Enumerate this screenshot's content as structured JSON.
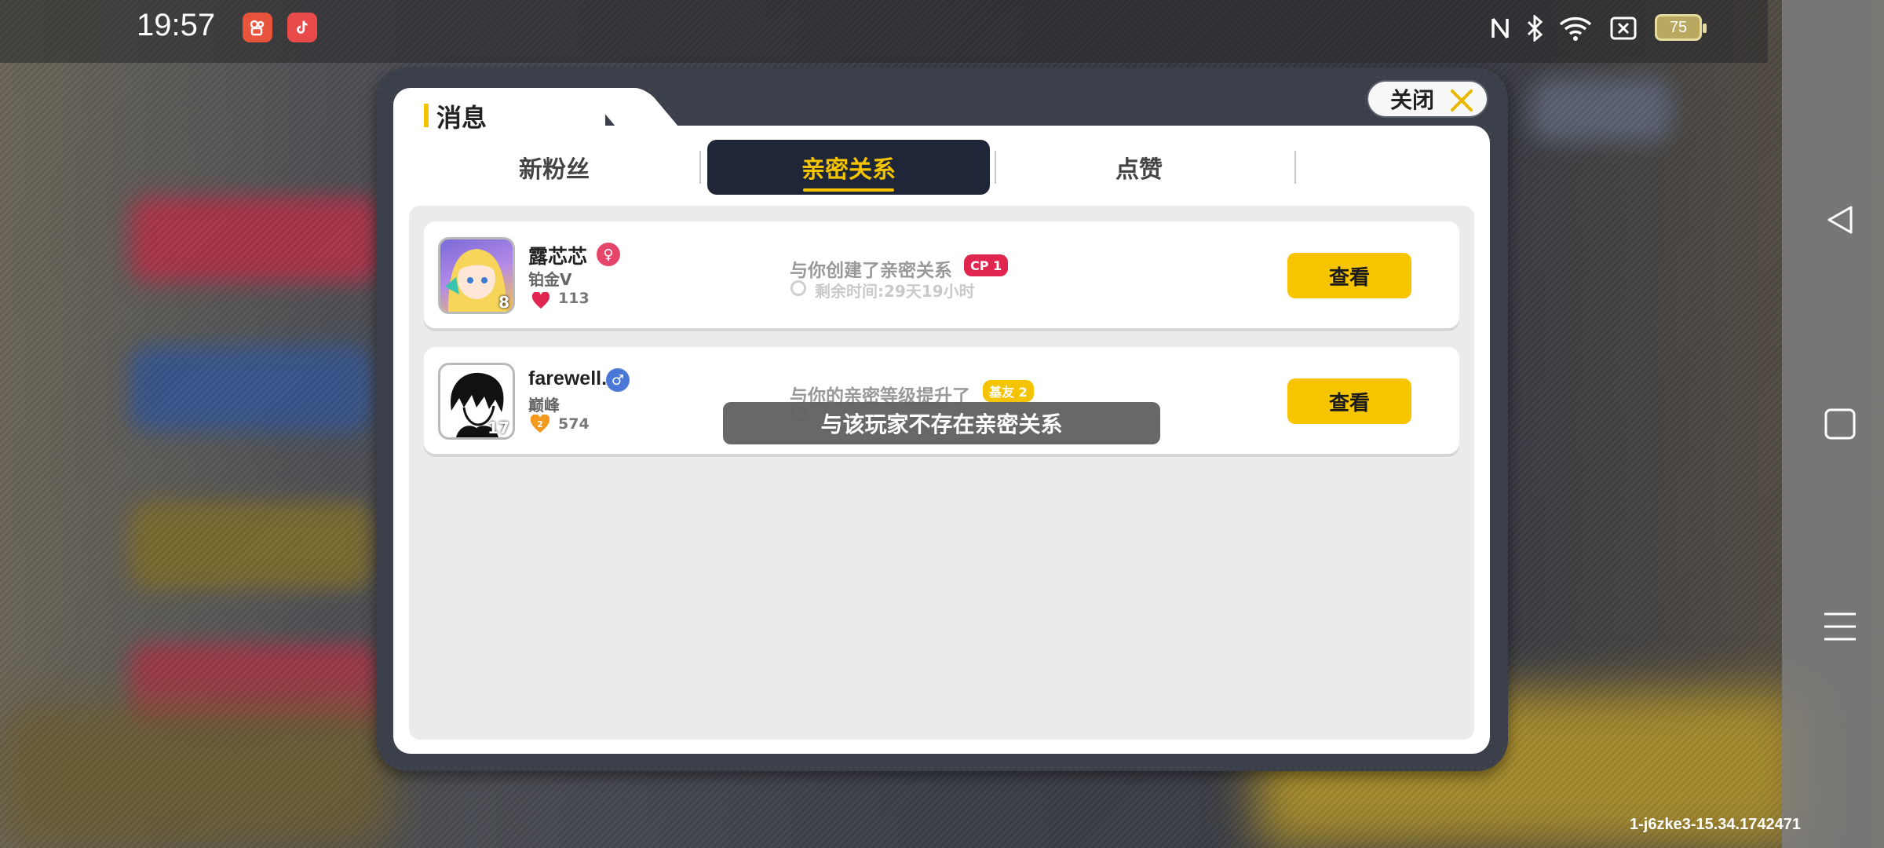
{
  "status_bar": {
    "time": "19:57",
    "battery": "75",
    "app_icons": [
      "kuaishou-icon",
      "douyin-icon"
    ],
    "system_icons": [
      "nfc-icon",
      "bluetooth-icon",
      "wifi-icon",
      "sim-off-icon",
      "battery-icon"
    ]
  },
  "dialog": {
    "title": "消息",
    "close_label": "关闭",
    "tabs": [
      {
        "label": "新粉丝",
        "active": false
      },
      {
        "label": "亲密关系",
        "active": true
      },
      {
        "label": "点赞",
        "active": false
      }
    ],
    "items": [
      {
        "name": "露芯芯",
        "gender": "female",
        "rank": "铂金V",
        "level": "8",
        "stat_icon": "heart-icon",
        "stat": "113",
        "message": "与你创建了亲密关系",
        "badge": "CP 1",
        "badge_color": "#e0264f",
        "timer": "剩余时间:29天19小时",
        "button": "查看"
      },
      {
        "name": "farewell.",
        "gender": "male",
        "rank": "巅峰",
        "level": "17",
        "stat_icon": "orange-heart-icon",
        "stat": "574",
        "message": "与你的亲密等级提升了",
        "badge": "基友 2",
        "badge_color": "#f5c400",
        "button": "查看"
      }
    ],
    "toast": "与该玩家不存在亲密关系"
  },
  "watermark": "1-j6zke3-15.34.1742471",
  "colors": {
    "accent": "#f5c400",
    "active_tab_bg": "#1e2638",
    "dialog_frame": "#3b3f49"
  }
}
